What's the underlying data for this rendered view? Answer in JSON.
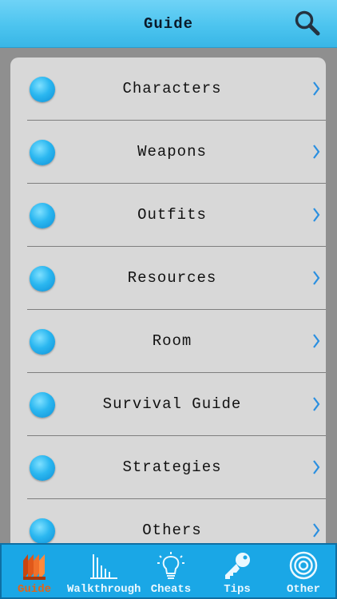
{
  "header": {
    "title": "Guide"
  },
  "menu": {
    "items": [
      {
        "label": "Characters"
      },
      {
        "label": "Weapons"
      },
      {
        "label": "Outfits"
      },
      {
        "label": "Resources"
      },
      {
        "label": "Room"
      },
      {
        "label": "Survival Guide"
      },
      {
        "label": "Strategies"
      },
      {
        "label": "Others"
      }
    ]
  },
  "tabbar": {
    "tabs": [
      {
        "label": "Guide",
        "icon": "book-stack-icon",
        "active": true
      },
      {
        "label": "Walkthrough",
        "icon": "bar-chart-icon",
        "active": false
      },
      {
        "label": "Cheats",
        "icon": "lightbulb-icon",
        "active": false
      },
      {
        "label": "Tips",
        "icon": "key-icon",
        "active": false
      },
      {
        "label": "Other",
        "icon": "target-icon",
        "active": false
      }
    ]
  },
  "colors": {
    "navbar": "#4cc4ef",
    "tabbar": "#1aa7e6",
    "active_tab": "#e06418",
    "bullet": "#2bb7f0",
    "chevron": "#2a8fe0"
  }
}
